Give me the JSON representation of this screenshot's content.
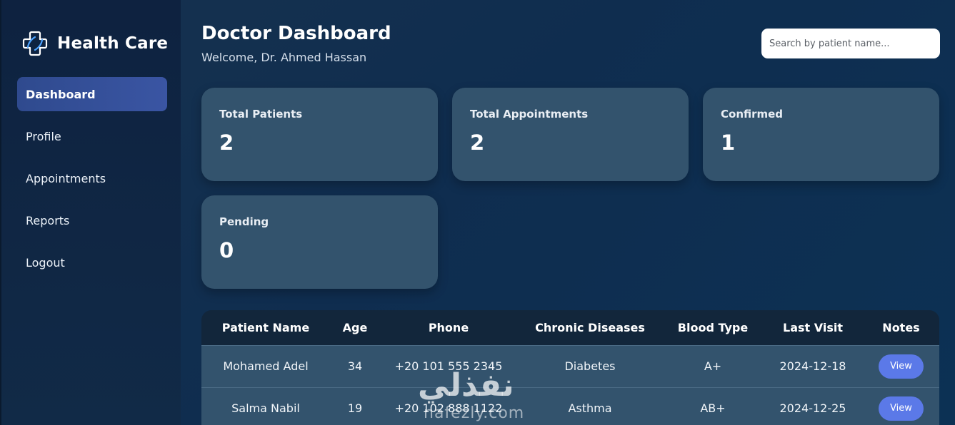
{
  "brand": {
    "title": "Health Care",
    "icon": "medical-cross-icon"
  },
  "nav": {
    "items": [
      {
        "label": "Dashboard",
        "active": true
      },
      {
        "label": "Profile",
        "active": false
      },
      {
        "label": "Appointments",
        "active": false
      },
      {
        "label": "Reports",
        "active": false
      },
      {
        "label": "Logout",
        "active": false
      }
    ]
  },
  "header": {
    "title": "Doctor Dashboard",
    "welcome": "Welcome, Dr. Ahmed Hassan",
    "search_placeholder": "Search by patient name..."
  },
  "stats": [
    {
      "label": "Total Patients",
      "value": "2"
    },
    {
      "label": "Total Appointments",
      "value": "2"
    },
    {
      "label": "Confirmed",
      "value": "1"
    },
    {
      "label": "Pending",
      "value": "0"
    }
  ],
  "table": {
    "columns": [
      "Patient Name",
      "Age",
      "Phone",
      "Chronic Diseases",
      "Blood Type",
      "Last Visit",
      "Notes"
    ],
    "rows": [
      {
        "name": "Mohamed Adel",
        "age": "34",
        "phone": "+20 101 555 2345",
        "disease": "Diabetes",
        "blood": "A+",
        "last_visit": "2024-12-18",
        "notes": "View"
      },
      {
        "name": "Salma Nabil",
        "age": "19",
        "phone": "+20 102 888 1122",
        "disease": "Asthma",
        "blood": "AB+",
        "last_visit": "2024-12-25",
        "notes": "View"
      }
    ]
  },
  "watermark": {
    "arabic": "نفذلي",
    "latin": "nafezly.com"
  },
  "colors": {
    "background": "#0f2d4f",
    "sidebar": "#0e2240",
    "active_nav": "#3a55a3",
    "card": "#33536d",
    "table_header": "#12263b",
    "view_button": "#5b79e8"
  }
}
